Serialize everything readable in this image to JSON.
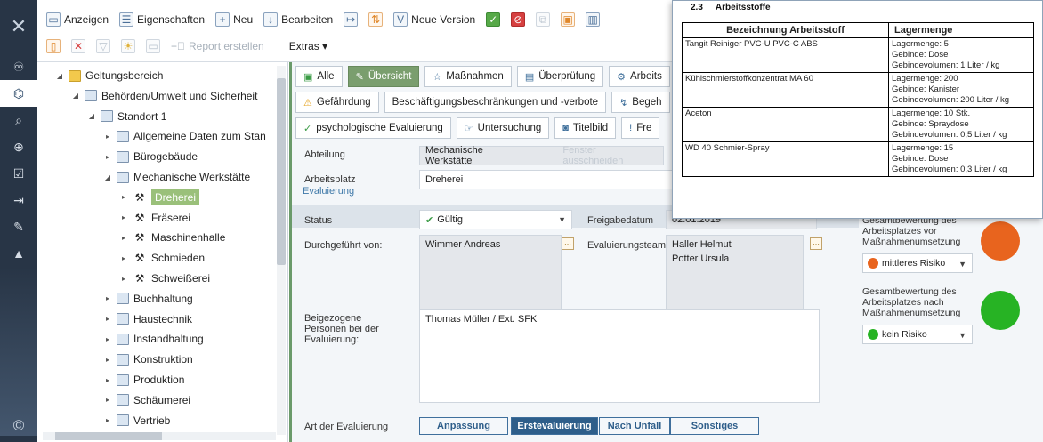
{
  "toolbar": {
    "row1": [
      {
        "label": "Anzeigen",
        "icon": "view-icon"
      },
      {
        "label": "Eigenschaften",
        "icon": "properties-icon"
      },
      {
        "label": "Neu",
        "icon": "new-icon"
      },
      {
        "label": "Bearbeiten",
        "icon": "edit-icon"
      },
      {
        "label": "",
        "icon": "export-icon"
      },
      {
        "label": "",
        "icon": "sort-icon"
      },
      {
        "label": "Neue Version",
        "icon": "version-icon"
      },
      {
        "label": "",
        "icon": "approve-icon"
      },
      {
        "label": "",
        "icon": "reject-icon"
      },
      {
        "label": "",
        "icon": "copy-icon"
      },
      {
        "label": "",
        "icon": "paste-icon"
      },
      {
        "label": "",
        "icon": "chart-icon"
      }
    ],
    "row2": {
      "report_label": "Report erstellen",
      "extras_label": "Extras ▾"
    }
  },
  "rail": {
    "items": [
      "binoculars-icon",
      "hierarchy-icon",
      "search-icon",
      "zoom-search-icon",
      "checklist-icon",
      "import-icon",
      "pen-icon",
      "graduation-icon"
    ],
    "copyright": "©"
  },
  "tree": {
    "items": [
      {
        "label": "Geltungsbereich",
        "level": 0,
        "toggle": "◢",
        "icon": "folder"
      },
      {
        "label": "Behörden/Umwelt und Sicherheit",
        "level": 1,
        "toggle": "◢",
        "icon": "node"
      },
      {
        "label": "Standort 1",
        "level": 2,
        "toggle": "◢",
        "icon": "node"
      },
      {
        "label": "Allgemeine Daten zum Stan",
        "level": 3,
        "toggle": "▸",
        "icon": "node"
      },
      {
        "label": "Bürogebäude",
        "level": 3,
        "toggle": "▸",
        "icon": "node"
      },
      {
        "label": "Mechanische Werkstätte",
        "level": 3,
        "toggle": "◢",
        "icon": "node"
      },
      {
        "label": "Dreherei",
        "level": 4,
        "toggle": "▸",
        "icon": "wp",
        "selected": true
      },
      {
        "label": "Fräserei",
        "level": 4,
        "toggle": "▸",
        "icon": "wp"
      },
      {
        "label": "Maschinenhalle",
        "level": 4,
        "toggle": "▸",
        "icon": "wp"
      },
      {
        "label": "Schmieden",
        "level": 4,
        "toggle": "▸",
        "icon": "wp"
      },
      {
        "label": "Schweißerei",
        "level": 4,
        "toggle": "▸",
        "icon": "wp"
      },
      {
        "label": "Buchhaltung",
        "level": 3,
        "toggle": "▸",
        "icon": "node"
      },
      {
        "label": "Haustechnik",
        "level": 3,
        "toggle": "▸",
        "icon": "node"
      },
      {
        "label": "Instandhaltung",
        "level": 3,
        "toggle": "▸",
        "icon": "node"
      },
      {
        "label": "Konstruktion",
        "level": 3,
        "toggle": "▸",
        "icon": "node"
      },
      {
        "label": "Produktion",
        "level": 3,
        "toggle": "▸",
        "icon": "node"
      },
      {
        "label": "Schäumerei",
        "level": 3,
        "toggle": "▸",
        "icon": "node"
      },
      {
        "label": "Vertrieb",
        "level": 3,
        "toggle": "▸",
        "icon": "node"
      }
    ]
  },
  "tabs": {
    "row1": [
      {
        "label": "Alle",
        "icon": "▣",
        "active": false
      },
      {
        "label": "Übersicht",
        "icon": "✎",
        "active": true
      },
      {
        "label": "Maßnahmen",
        "icon": "☆",
        "active": false
      },
      {
        "label": "Überprüfung",
        "icon": "▤",
        "active": false
      },
      {
        "label": "Arbeits",
        "icon": "⚙",
        "active": false
      }
    ],
    "row2": [
      {
        "label": "Gefährdung",
        "icon": "⚠"
      },
      {
        "label": "Beschäftigungsbeschränkungen und -verbote",
        "icon": ""
      },
      {
        "label": "Begeh",
        "icon": "↯"
      }
    ],
    "row3": [
      {
        "label": "psychologische Evaluierung",
        "icon": "✓"
      },
      {
        "label": "Untersuchung",
        "icon": "☞"
      },
      {
        "label": "Titelbild",
        "icon": "◙"
      },
      {
        "label": "Fre",
        "icon": "!"
      }
    ]
  },
  "form": {
    "abteilung_label": "Abteilung",
    "abteilung_value": "Mechanische Werkstätte",
    "fenster_label": "Fenster ausschneiden",
    "arbeitsplatz_label": "Arbeitsplatz",
    "arbeitsplatz_value": "Dreherei",
    "section_evaluierung": "Evaluierung",
    "status_label": "Status",
    "status_value": "Gültig",
    "freigabe_label": "Freigabedatum",
    "freigabe_value": "02.01.2019",
    "durchgefuehrt_label": "Durchgeführt von:",
    "durchgefuehrt_value": "Wimmer Andreas",
    "team_label": "Evaluierungsteam:",
    "team_values": [
      "Haller Helmut",
      "Potter Ursula"
    ],
    "beigezogene_label": "Beigezogene Personen bei der Evaluierung:",
    "beigezogene_value": "Thomas Müller / Ext. SFK",
    "art_label": "Art der Evaluierung",
    "art_options": [
      {
        "label": "Anpassung",
        "on": false
      },
      {
        "label": "Erstevaluierung",
        "on": true
      },
      {
        "label": "Nach Unfall",
        "on": false
      },
      {
        "label": "Sonstiges",
        "on": false
      }
    ]
  },
  "risk": {
    "before_label": "Gesamtbewertung des Arbeitsplatzes vor Maßnahmenumsetzung",
    "before_value": "mittleres Risiko",
    "before_color": "#e8641e",
    "after_label": "Gesamtbewertung des Arbeitsplatzes nach Maßnahmenumsetzung",
    "after_value": "kein Risiko",
    "after_color": "#27b324"
  },
  "doc": {
    "section_no": "2.3",
    "section_title": "Arbeitsstoffe",
    "col1": "Bezeichnung Arbeitsstoff",
    "col2": "Lagermenge",
    "rows": [
      {
        "name": "Tangit Reiniger PVC-U PVC-C ABS",
        "lines": [
          "Lagermenge: 5",
          "Gebinde: Dose",
          "Gebindevolumen: 1 Liter / kg"
        ]
      },
      {
        "name": "Kühlschmierstoffkonzentrat MA 60",
        "lines": [
          "Lagermenge: 200",
          "Gebinde: Kanister",
          "Gebindevolumen: 200 Liter / kg"
        ]
      },
      {
        "name": "Aceton",
        "lines": [
          "Lagermenge: 10 Stk.",
          "Gebinde: Spraydose",
          "Gebindevolumen: 0,5 Liter / kg"
        ]
      },
      {
        "name": "WD 40 Schmier-Spray",
        "lines": [
          "Lagermenge: 15",
          "Gebinde: Dose",
          "Gebindevolumen: 0,3 Liter / kg"
        ]
      }
    ]
  }
}
